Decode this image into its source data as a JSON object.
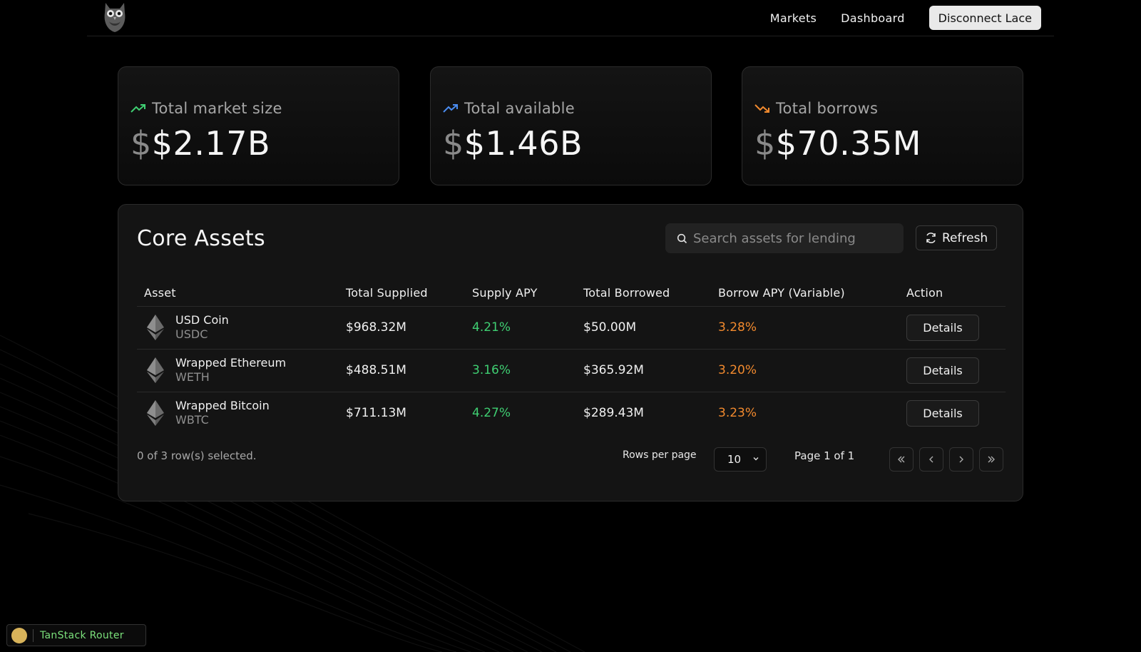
{
  "nav": {
    "links": [
      "Markets",
      "Dashboard"
    ],
    "disconnect_label": "Disconnect Lace"
  },
  "stats": [
    {
      "label": "Total market size",
      "prefix": "$",
      "value": "$2.17B",
      "trend": "up",
      "icon": "trend-up-icon",
      "color": "#3fcf72"
    },
    {
      "label": "Total available",
      "prefix": "$",
      "value": "$1.46B",
      "trend": "up",
      "icon": "trend-up-icon",
      "color": "#4a8cf0"
    },
    {
      "label": "Total borrows",
      "prefix": "$",
      "value": "$70.35M",
      "trend": "down",
      "icon": "trend-down-icon",
      "color": "#f28a2e"
    }
  ],
  "panel": {
    "title": "Core Assets",
    "search_placeholder": "Search assets for lending",
    "refresh_label": "Refresh"
  },
  "table": {
    "headers": [
      "Asset",
      "Total Supplied",
      "Supply APY",
      "Total Borrowed",
      "Borrow APY (Variable)",
      "Action"
    ],
    "rows": [
      {
        "name": "USD Coin",
        "symbol": "USDC",
        "supplied": "$968.32M",
        "supply_apy": "4.21%",
        "borrowed": "$50.00M",
        "borrow_apy": "3.28%",
        "action": "Details"
      },
      {
        "name": "Wrapped Ethereum",
        "symbol": "WETH",
        "supplied": "$488.51M",
        "supply_apy": "3.16%",
        "borrowed": "$365.92M",
        "borrow_apy": "3.20%",
        "action": "Details"
      },
      {
        "name": "Wrapped Bitcoin",
        "symbol": "WBTC",
        "supplied": "$711.13M",
        "supply_apy": "4.27%",
        "borrowed": "$289.43M",
        "borrow_apy": "3.23%",
        "action": "Details"
      }
    ]
  },
  "footer": {
    "selected_text": "0 of 3 row(s) selected.",
    "rows_per_page_label": "Rows per page",
    "rows_per_page_value": "10",
    "page_text": "Page 1 of 1"
  },
  "devtools": {
    "label": "TanStack Router"
  },
  "colors": {
    "positive": "#3fcf72",
    "negative": "#f28a2e",
    "background": "#000000",
    "panel": "#141414"
  }
}
